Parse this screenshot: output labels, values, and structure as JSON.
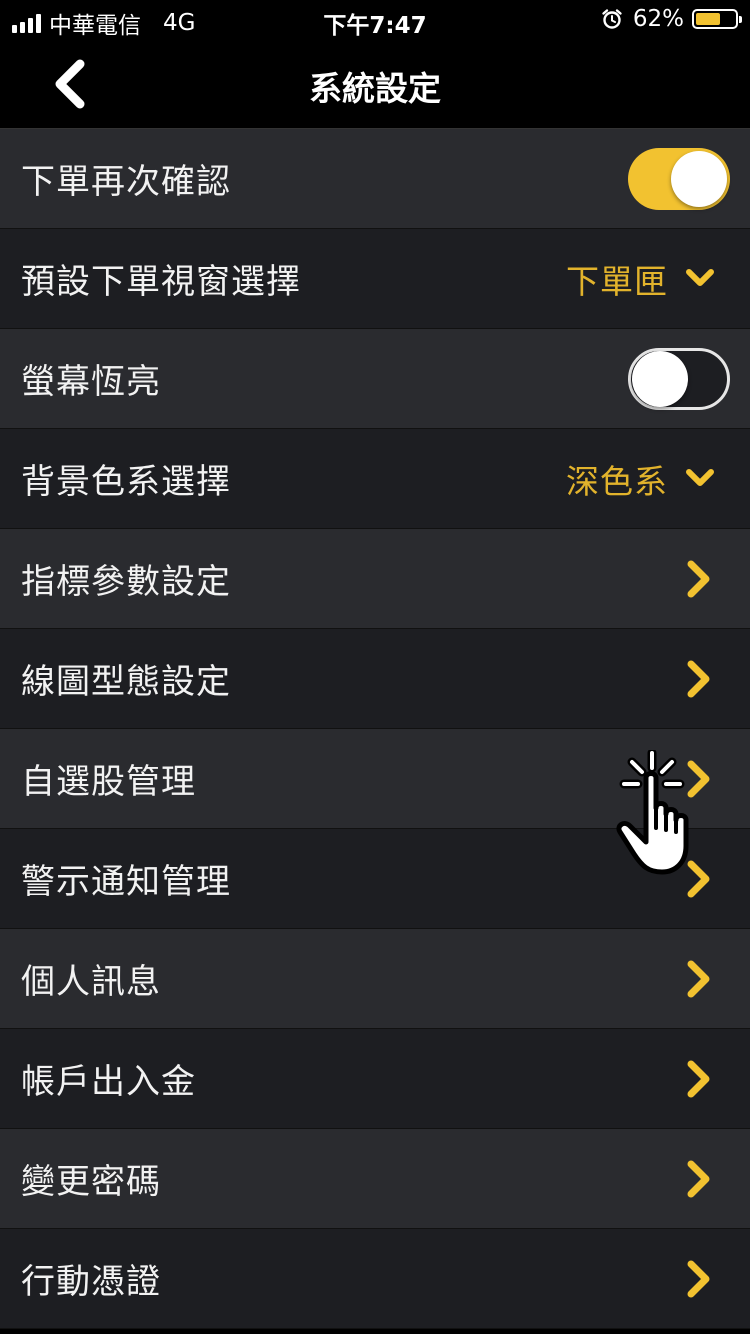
{
  "status_bar": {
    "carrier": "中華電信",
    "network": "4G",
    "time": "下午7:47",
    "battery_percent": "62%",
    "battery_level": 0.62
  },
  "nav": {
    "title": "系統設定",
    "back_icon": "chevron-left-icon"
  },
  "colors": {
    "accent": "#f2c230",
    "select_text": "#e2b32c",
    "row_light": "#2a2b2f",
    "row_dark": "#1d1e22"
  },
  "settings": [
    {
      "label": "下單再次確認",
      "control": "toggle",
      "on": true
    },
    {
      "label": "預設下單視窗選擇",
      "control": "select",
      "value": "下單匣"
    },
    {
      "label": "螢幕恆亮",
      "control": "toggle",
      "on": false
    },
    {
      "label": "背景色系選擇",
      "control": "select",
      "value": "深色系"
    },
    {
      "label": "指標參數設定",
      "control": "link"
    },
    {
      "label": "線圖型態設定",
      "control": "link"
    },
    {
      "label": "自選股管理",
      "control": "link"
    },
    {
      "label": "警示通知管理",
      "control": "link"
    },
    {
      "label": "個人訊息",
      "control": "link"
    },
    {
      "label": "帳戶出入金",
      "control": "link"
    },
    {
      "label": "變更密碼",
      "control": "link"
    },
    {
      "label": "行動憑證",
      "control": "link"
    }
  ]
}
